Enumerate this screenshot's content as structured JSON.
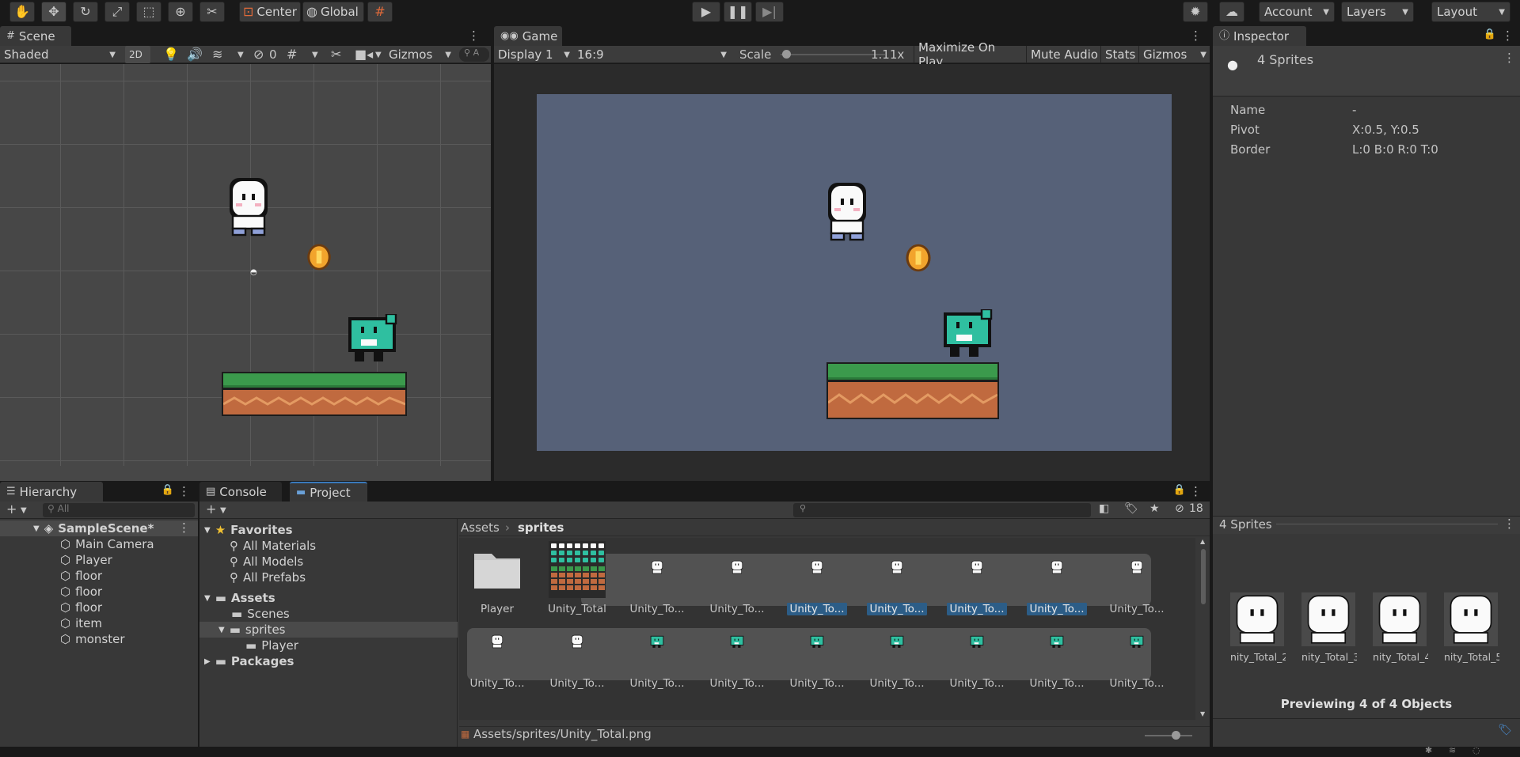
{
  "toolbar": {
    "tools": [
      "hand-icon",
      "move-icon",
      "rotate-icon",
      "scale-icon",
      "rect-icon",
      "transform-icon",
      "custom-tool-icon"
    ],
    "pivot_mode": "Center",
    "pivot_rotation": "Global",
    "account_label": "Account",
    "layers_label": "Layers",
    "layout_label": "Layout"
  },
  "scene": {
    "tab_label": "Scene",
    "shading_mode": "Shaded",
    "mode_2d": "2D",
    "hidden_count": "0",
    "gizmos_label": "Gizmos",
    "search_placeholder": "A"
  },
  "game": {
    "tab_label": "Game",
    "display": "Display 1",
    "aspect": "16:9",
    "scale_label": "Scale",
    "scale_value": "1.11x",
    "maximize": "Maximize On Play",
    "mute": "Mute Audio",
    "stats": "Stats",
    "gizmos_label": "Gizmos",
    "bg_color": "#566178"
  },
  "inspector": {
    "tab_label": "Inspector",
    "object_title": "4 Sprites",
    "fields": [
      {
        "label": "Name",
        "value": "-"
      },
      {
        "label": "Pivot",
        "value": "X:0.5, Y:0.5"
      },
      {
        "label": "Border",
        "value": "L:0 B:0 R:0 T:0"
      }
    ],
    "preview_title": "4 Sprites",
    "preview_items": [
      "nity_Total_2",
      "nity_Total_3",
      "nity_Total_4",
      "nity_Total_5"
    ],
    "preview_caption": "Previewing 4 of 4 Objects"
  },
  "hierarchy": {
    "tab_label": "Hierarchy",
    "search_placeholder": "All",
    "scene_name": "SampleScene*",
    "objects": [
      "Main Camera",
      "Player",
      "floor",
      "floor",
      "floor",
      "item",
      "monster"
    ]
  },
  "project": {
    "console_tab": "Console",
    "project_tab": "Project",
    "hidden_count": "18",
    "favorites_label": "Favorites",
    "favorites": [
      "All Materials",
      "All Models",
      "All Prefabs"
    ],
    "assets_label": "Assets",
    "assets_children": [
      "Scenes",
      "sprites"
    ],
    "sprites_child": "Player",
    "packages_label": "Packages",
    "breadcrumb": [
      "Assets",
      "sprites"
    ],
    "row1": [
      {
        "label": "Player",
        "kind": "folder"
      },
      {
        "label": "Unity_Total",
        "kind": "sheet"
      },
      {
        "label": "Unity_To...",
        "kind": "ghost"
      },
      {
        "label": "Unity_To...",
        "kind": "ghost"
      },
      {
        "label": "Unity_To...",
        "kind": "ghost",
        "selected": true
      },
      {
        "label": "Unity_To...",
        "kind": "ghost",
        "selected": true
      },
      {
        "label": "Unity_To...",
        "kind": "ghost",
        "selected": true
      },
      {
        "label": "Unity_To...",
        "kind": "ghost",
        "selected": true
      },
      {
        "label": "Unity_To...",
        "kind": "ghost"
      }
    ],
    "row2": [
      {
        "label": "Unity_To...",
        "kind": "ghost"
      },
      {
        "label": "Unity_To...",
        "kind": "ghost"
      },
      {
        "label": "Unity_To...",
        "kind": "cat"
      },
      {
        "label": "Unity_To...",
        "kind": "cat"
      },
      {
        "label": "Unity_To...",
        "kind": "cat"
      },
      {
        "label": "Unity_To...",
        "kind": "cat"
      },
      {
        "label": "Unity_To...",
        "kind": "cat"
      },
      {
        "label": "Unity_To...",
        "kind": "cat"
      },
      {
        "label": "Unity_To...",
        "kind": "cat"
      }
    ],
    "status_path": "Assets/sprites/Unity_Total.png"
  },
  "colors": {
    "accent": "#3a79bb",
    "selection": "#2c5d87",
    "grass": "#3b9a4c",
    "dirt": "#c06a3f",
    "cat": "#2fbfa0"
  }
}
